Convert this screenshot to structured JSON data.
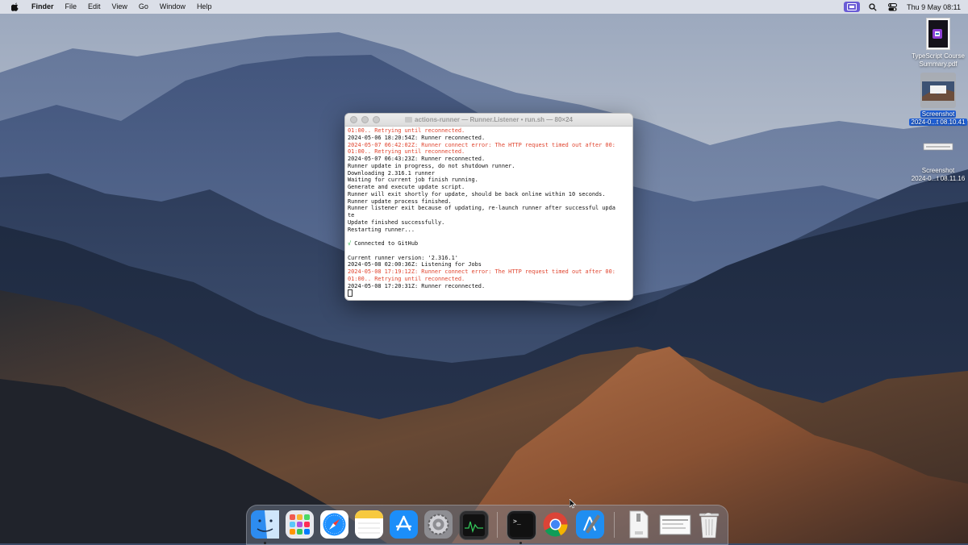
{
  "menubar": {
    "apple": "apple-menu",
    "app_name": "Finder",
    "items": [
      "File",
      "Edit",
      "View",
      "Go",
      "Window",
      "Help"
    ],
    "clock": "Thu 9 May  08:11"
  },
  "desktop": {
    "icons": [
      {
        "label_line1": "TypeScript Course",
        "label_line2": "Summary.pdf",
        "selected": false
      },
      {
        "label_line1": "Screenshot",
        "label_line2": "2024-0...t 08.10.41",
        "selected": true
      },
      {
        "label_line1": "Screenshot",
        "label_line2": "2024-0...t 08.11.16",
        "selected": false
      }
    ]
  },
  "terminal": {
    "title": "actions-runner — Runner.Listener • run.sh — 80×24",
    "lines": [
      {
        "text": "01:00.. Retrying until reconnected.",
        "type": "error"
      },
      {
        "text": "2024-05-06 18:20:54Z: Runner reconnected.",
        "type": "normal"
      },
      {
        "text": "2024-05-07 06:42:02Z: Runner connect error: The HTTP request timed out after 00:",
        "type": "error"
      },
      {
        "text": "01:00.. Retrying until reconnected.",
        "type": "error"
      },
      {
        "text": "2024-05-07 06:43:23Z: Runner reconnected.",
        "type": "normal"
      },
      {
        "text": "Runner update in progress, do not shutdown runner.",
        "type": "normal"
      },
      {
        "text": "Downloading 2.316.1 runner",
        "type": "normal"
      },
      {
        "text": "Waiting for current job finish running.",
        "type": "normal"
      },
      {
        "text": "Generate and execute update script.",
        "type": "normal"
      },
      {
        "text": "Runner will exit shortly for update, should be back online within 10 seconds.",
        "type": "normal"
      },
      {
        "text": "Runner update process finished.",
        "type": "normal"
      },
      {
        "text": "Runner listener exit because of updating, re-launch runner after successful upda",
        "type": "normal"
      },
      {
        "text": "te",
        "type": "normal"
      },
      {
        "text": "Update finished successfully.",
        "type": "normal"
      },
      {
        "text": "Restarting runner...",
        "type": "normal"
      },
      {
        "text": "",
        "type": "normal"
      },
      {
        "text": "√ Connected to GitHub",
        "type": "success"
      },
      {
        "text": "",
        "type": "normal"
      },
      {
        "text": "Current runner version: '2.316.1'",
        "type": "normal"
      },
      {
        "text": "2024-05-08 02:00:36Z: Listening for Jobs",
        "type": "normal"
      },
      {
        "text": "2024-05-08 17:19:12Z: Runner connect error: The HTTP request timed out after 00:",
        "type": "error"
      },
      {
        "text": "01:00.. Retrying until reconnected.",
        "type": "error"
      },
      {
        "text": "2024-05-08 17:20:31Z: Runner reconnected.",
        "type": "normal"
      }
    ]
  },
  "dock": {
    "apps": [
      {
        "name": "finder-icon",
        "running": true
      },
      {
        "name": "launchpad-icon",
        "running": false
      },
      {
        "name": "safari-icon",
        "running": false
      },
      {
        "name": "notes-icon",
        "running": false
      },
      {
        "name": "app-store-icon",
        "running": false
      },
      {
        "name": "system-settings-icon",
        "running": false
      },
      {
        "name": "activity-monitor-icon",
        "running": false
      },
      {
        "name": "terminal-icon",
        "running": true
      },
      {
        "name": "chrome-icon",
        "running": false
      },
      {
        "name": "xcode-icon",
        "running": false
      },
      {
        "name": "document-icon",
        "running": false
      },
      {
        "name": "screenshot-thumbnail-icon",
        "running": false
      },
      {
        "name": "trash-icon",
        "running": false
      }
    ]
  },
  "colors": {
    "terminal_error": "#e0442e",
    "terminal_success": "#29b045",
    "selection": "#1f5fd6",
    "menubar_active": "#6a5cd6"
  }
}
